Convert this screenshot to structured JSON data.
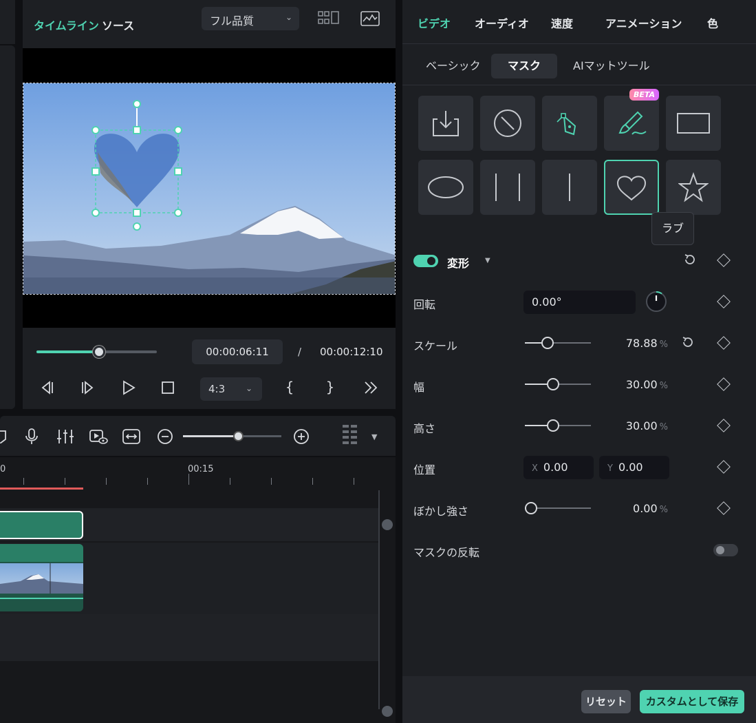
{
  "player": {
    "tabs": [
      "タイムライン",
      "ソース"
    ],
    "quality": "フル品質",
    "current_time": "00:00:06:11",
    "separator": "/",
    "total_time": "00:00:12:10",
    "progress": 0.52,
    "aspect_ratio": "4:3"
  },
  "timeline": {
    "ruler_labels": [
      "0",
      "00:15"
    ]
  },
  "panel": {
    "tabs": [
      "ビデオ",
      "オーディオ",
      "速度",
      "アニメーション",
      "色"
    ],
    "active_tab": "ビデオ",
    "subtabs": [
      "ベーシック",
      "マスク",
      "AIマットツール"
    ],
    "active_subtab": "マスク",
    "beta_badge": "BETA",
    "mask_shapes": [
      "import-icon",
      "none-icon",
      "pen-icon",
      "brush-icon",
      "rectangle-icon",
      "ellipse-icon",
      "double-line-icon",
      "single-line-icon",
      "heart-icon",
      "star-icon"
    ],
    "tooltip": "ラブ",
    "transform": {
      "label": "変形",
      "enabled": true
    },
    "rotation": {
      "label": "回転",
      "value": "0.00°"
    },
    "scale": {
      "label": "スケール",
      "value": "78.88",
      "unit": "%",
      "slider": 0.25
    },
    "width": {
      "label": "幅",
      "value": "30.00",
      "unit": "%",
      "slider": 0.33
    },
    "height": {
      "label": "高さ",
      "value": "30.00",
      "unit": "%",
      "slider": 0.33
    },
    "position": {
      "label": "位置",
      "x_axis": "X",
      "x": "0.00",
      "y_axis": "Y",
      "y": "0.00"
    },
    "blur": {
      "label": "ぼかし強さ",
      "value": "0.00",
      "unit": "%",
      "slider": 0.0
    },
    "invert": {
      "label": "マスクの反転",
      "enabled": false
    },
    "reset_button": "リセット",
    "save_button": "カスタムとして保存"
  },
  "colors": {
    "accent": "#4fd3b1",
    "playhead": "#e05a5a",
    "clip": "#2a7f66"
  }
}
